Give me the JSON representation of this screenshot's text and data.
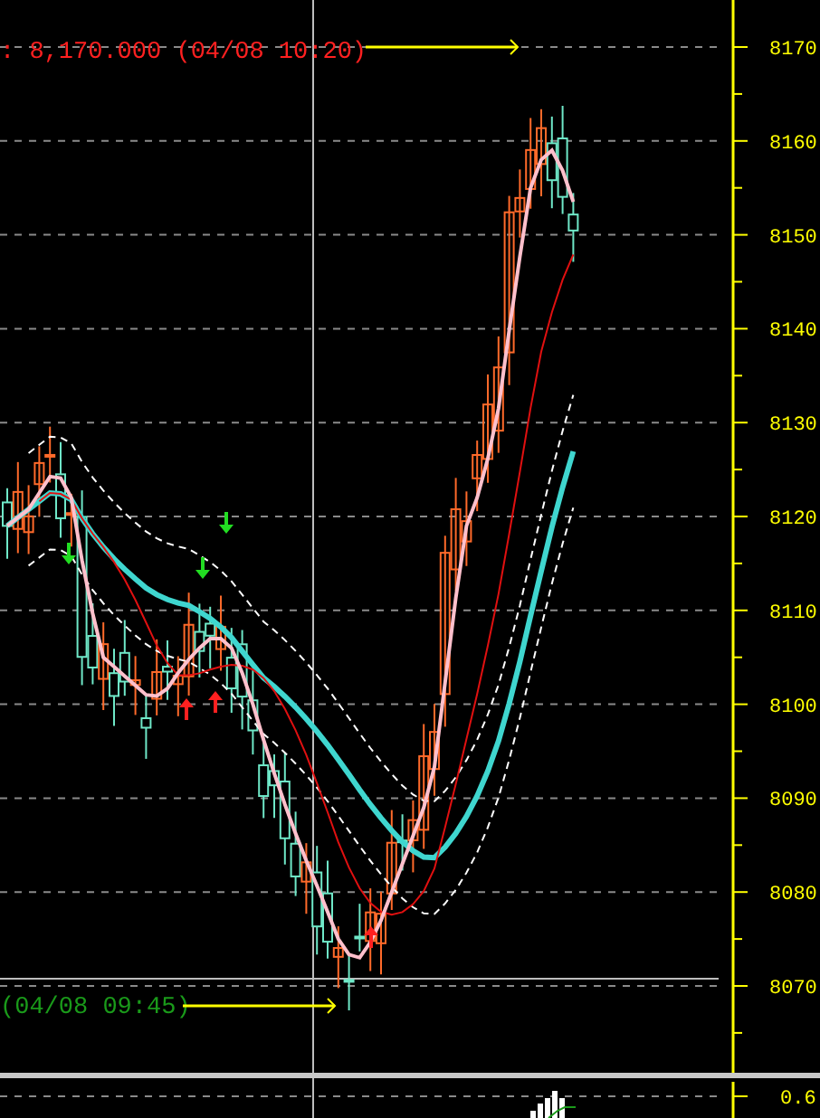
{
  "price_axis": {
    "ticks": [
      "8170",
      "8160",
      "8150",
      "8140",
      "8130",
      "8120",
      "8110",
      "8100",
      "8090",
      "8080",
      "8070"
    ]
  },
  "annotations": {
    "high_label": ": 8,170.000 (04/08 10:20)",
    "low_label": "(04/08 09:45)"
  },
  "indicator_axis": {
    "ticks": [
      "0.6"
    ]
  }
}
